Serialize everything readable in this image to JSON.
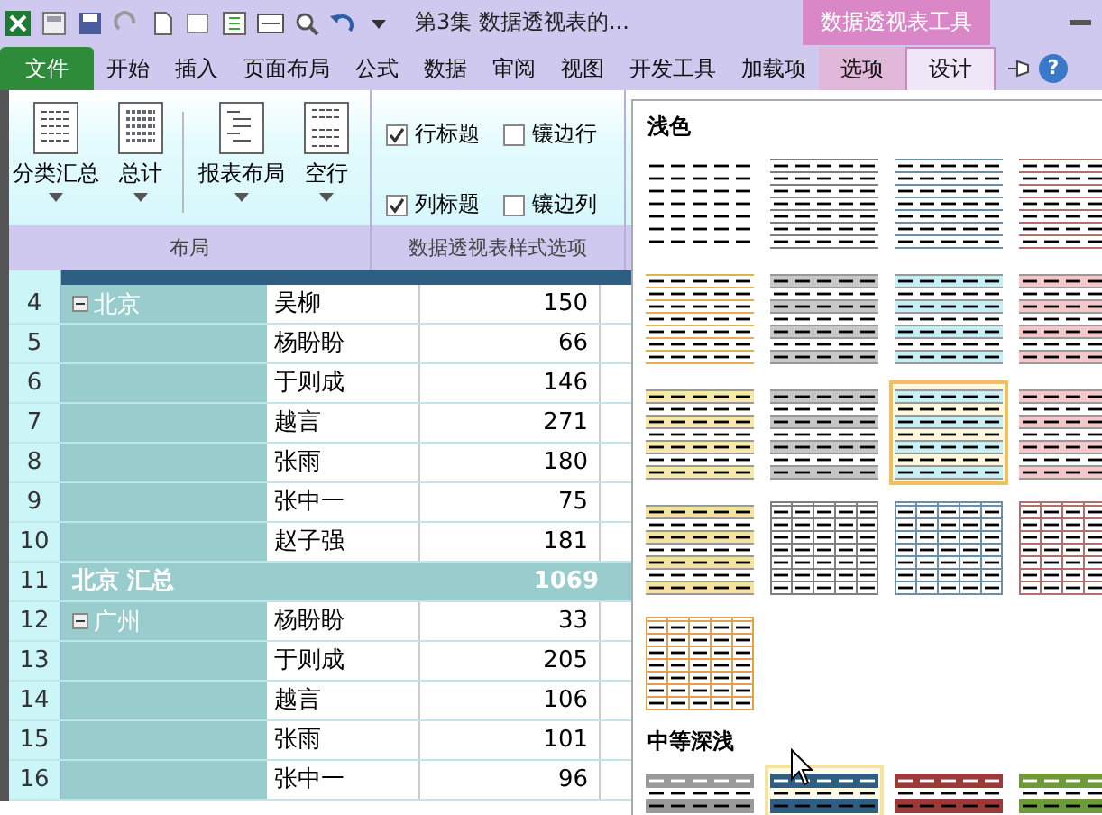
{
  "title_bar": {
    "title": "第3集 数据透视表的...",
    "context_title": "数据透视表工具"
  },
  "tabs": [
    {
      "label": "文件",
      "kind": "file",
      "selected": false
    },
    {
      "label": "开始",
      "kind": "normal",
      "selected": false
    },
    {
      "label": "插入",
      "kind": "normal",
      "selected": false
    },
    {
      "label": "页面布局",
      "kind": "normal",
      "selected": false
    },
    {
      "label": "公式",
      "kind": "normal",
      "selected": false
    },
    {
      "label": "数据",
      "kind": "normal",
      "selected": false
    },
    {
      "label": "审阅",
      "kind": "normal",
      "selected": false
    },
    {
      "label": "视图",
      "kind": "normal",
      "selected": false
    },
    {
      "label": "开发工具",
      "kind": "normal",
      "selected": false
    },
    {
      "label": "加载项",
      "kind": "normal",
      "selected": false
    },
    {
      "label": "选项",
      "kind": "context",
      "selected": false
    },
    {
      "label": "设计",
      "kind": "context",
      "selected": true
    }
  ],
  "help": "?",
  "ribbon": {
    "layout_group": {
      "label": "布局",
      "buttons": [
        {
          "label": "分类汇总"
        },
        {
          "label": "总计"
        },
        {
          "label": "报表布局"
        },
        {
          "label": "空行"
        }
      ]
    },
    "options_group": {
      "label": "数据透视表样式选项",
      "checkboxes": [
        {
          "label": "行标题",
          "checked": true
        },
        {
          "label": "镶边行",
          "checked": false
        },
        {
          "label": "列标题",
          "checked": true
        },
        {
          "label": "镶边列",
          "checked": false
        }
      ]
    }
  },
  "sheet": {
    "rows": [
      {
        "row": "4",
        "kind": "item",
        "region": "北京",
        "expanded": true,
        "name": "吴柳",
        "value": "150"
      },
      {
        "row": "5",
        "kind": "item",
        "name": "杨盼盼",
        "value": "66"
      },
      {
        "row": "6",
        "kind": "item",
        "name": "于则成",
        "value": "146"
      },
      {
        "row": "7",
        "kind": "item",
        "name": "越言",
        "value": "271"
      },
      {
        "row": "8",
        "kind": "item",
        "name": "张雨",
        "value": "180"
      },
      {
        "row": "9",
        "kind": "item",
        "name": "张中一",
        "value": "75"
      },
      {
        "row": "10",
        "kind": "item",
        "name": "赵子强",
        "value": "181"
      },
      {
        "row": "11",
        "kind": "subtotal",
        "label": "北京 汇总",
        "value": "1069"
      },
      {
        "row": "12",
        "kind": "item",
        "region": "广州",
        "expanded": true,
        "name": "杨盼盼",
        "value": "33"
      },
      {
        "row": "13",
        "kind": "item",
        "name": "于则成",
        "value": "205"
      },
      {
        "row": "14",
        "kind": "item",
        "name": "越言",
        "value": "106"
      },
      {
        "row": "15",
        "kind": "item",
        "name": "张雨",
        "value": "101"
      },
      {
        "row": "16",
        "kind": "item",
        "name": "张中一",
        "value": "96"
      }
    ]
  },
  "gallery": {
    "sections": [
      {
        "title": "浅色",
        "styles": [
          {
            "kind": "plain",
            "color": "#000000",
            "selected": false,
            "hovered": false
          },
          {
            "kind": "lines",
            "color": "#808080",
            "selected": false,
            "hovered": false
          },
          {
            "kind": "lines",
            "color": "#6b8fa8",
            "selected": false,
            "hovered": false
          },
          {
            "kind": "lines",
            "color": "#b07070",
            "selected": false,
            "hovered": false
          },
          {
            "kind": "lines",
            "color": "#e0b050",
            "selected": false,
            "hovered": false
          },
          {
            "kind": "banded",
            "color": "#c8c8c8",
            "selected": false,
            "hovered": false
          },
          {
            "kind": "banded",
            "color": "#c6eef5",
            "selected": false,
            "hovered": false
          },
          {
            "kind": "banded",
            "color": "#f4c7c9",
            "selected": false,
            "hovered": false
          },
          {
            "kind": "banded",
            "color": "#f7e9a9",
            "selected": false,
            "hovered": false
          },
          {
            "kind": "banded",
            "color": "#c6c6c6",
            "selected": false,
            "hovered": false
          },
          {
            "kind": "banded",
            "color": "#c8f0f4",
            "selected": true,
            "hovered": false
          },
          {
            "kind": "banded",
            "color": "#f4c7c9",
            "selected": false,
            "hovered": false
          },
          {
            "kind": "banded",
            "color": "#f5e3a0",
            "selected": false,
            "hovered": false
          },
          {
            "kind": "grid",
            "color": "#808080",
            "selected": false,
            "hovered": false
          },
          {
            "kind": "grid",
            "color": "#6b8fa8",
            "selected": false,
            "hovered": false
          },
          {
            "kind": "grid",
            "color": "#b07070",
            "selected": false,
            "hovered": false
          },
          {
            "kind": "grid",
            "color": "#e0a050",
            "selected": false,
            "hovered": false
          }
        ]
      },
      {
        "title": "中等深浅",
        "styles": [
          {
            "kind": "dark",
            "color": "#9a9a9a",
            "selected": false,
            "hovered": false
          },
          {
            "kind": "dark",
            "color": "#2e5f82",
            "selected": false,
            "hovered": true
          },
          {
            "kind": "dark",
            "color": "#9c3a3a",
            "selected": false,
            "hovered": false
          },
          {
            "kind": "dark",
            "color": "#6e9a3a",
            "selected": false,
            "hovered": false
          }
        ]
      }
    ]
  }
}
